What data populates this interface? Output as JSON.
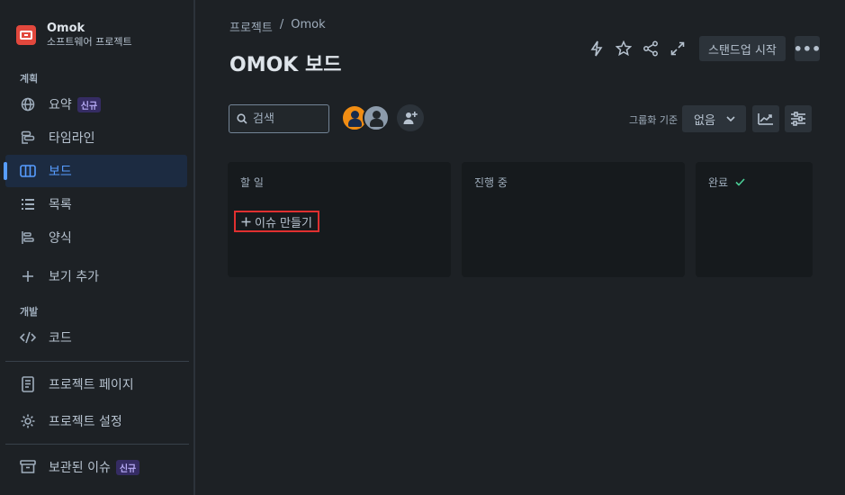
{
  "sidebar": {
    "project_name": "Omok",
    "project_type": "소프트웨어 프로젝트",
    "section_planning": "계획",
    "section_development": "개발",
    "items": [
      {
        "label": "요약",
        "badge": "신규",
        "icon": "globe-icon"
      },
      {
        "label": "타임라인",
        "icon": "timeline-icon"
      },
      {
        "label": "보드",
        "icon": "board-icon",
        "active": true
      },
      {
        "label": "목록",
        "icon": "list-icon"
      },
      {
        "label": "양식",
        "icon": "form-icon"
      },
      {
        "label": "보기 추가",
        "icon": "plus-icon"
      },
      {
        "label": "코드",
        "icon": "code-icon"
      },
      {
        "label": "프로젝트 페이지",
        "icon": "page-icon"
      },
      {
        "label": "프로젝트 설정",
        "icon": "gear-icon"
      },
      {
        "label": "보관된 이슈",
        "badge": "신규",
        "icon": "archive-icon"
      }
    ]
  },
  "header": {
    "breadcrumb": [
      "프로젝트",
      "/",
      "Omok"
    ],
    "title": "OMOK 보드",
    "standup_label": "스탠드업 시작",
    "more_label": "•••"
  },
  "toolbar": {
    "search_placeholder": "검색",
    "group_by_label": "그룹화 기준",
    "group_by_value": "없음"
  },
  "columns": [
    {
      "title": "할 일",
      "create_label": "이슈 만들기"
    },
    {
      "title": "진행 중"
    },
    {
      "title": "완료",
      "done": true
    }
  ],
  "colors": {
    "accent": "#579dff",
    "highlight_border": "#e03030",
    "done_check": "#4bce97"
  }
}
